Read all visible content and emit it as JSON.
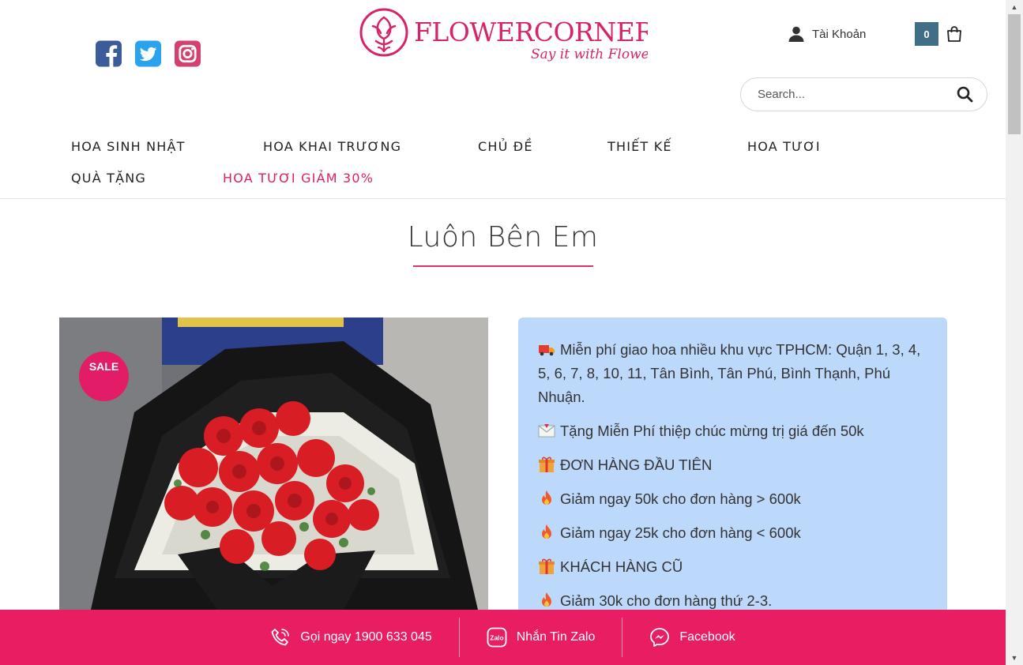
{
  "header": {
    "logo": {
      "brand": "FLOWERCORNER",
      "tagline": "Say it with Flowers"
    },
    "social": [
      "facebook",
      "twitter",
      "instagram"
    ],
    "account_label": "Tài Khoản",
    "cart_count": "0",
    "search_placeholder": "Search..."
  },
  "nav": {
    "items": [
      {
        "label": "HOA SINH NHẬT"
      },
      {
        "label": "HOA KHAI TRƯƠNG"
      },
      {
        "label": "CHỦ ĐỀ"
      },
      {
        "label": "THIẾT KẾ"
      },
      {
        "label": "HOA TƯƠI"
      },
      {
        "label": "QUÀ TẶNG"
      },
      {
        "label": "HOA TƯƠI GIẢM 30%"
      }
    ]
  },
  "product": {
    "title": "Luôn Bên Em",
    "badge": "SALE"
  },
  "promo": {
    "lines": [
      {
        "icon": "truck-emoji",
        "text": "Miễn phí giao hoa nhiều khu vực TPHCM: Quận 1, 3, 4, 5, 6, 7, 8, 10, 11, Tân Bình, Tân Phú, Bình Thạnh, Phú Nhuận."
      },
      {
        "icon": "envelope-emoji",
        "text": "Tặng Miễn Phí thiệp chúc mừng trị giá đến 50k"
      },
      {
        "icon": "gift-emoji",
        "text": "ĐƠN HÀNG ĐẦU TIÊN"
      },
      {
        "icon": "fire-emoji",
        "text": "Giảm ngay 50k cho đơn hàng > 600k"
      },
      {
        "icon": "fire-emoji",
        "text": "Giảm ngay 25k cho đơn hàng < 600k"
      },
      {
        "icon": "gift-emoji",
        "text": "KHÁCH HÀNG CŨ"
      },
      {
        "icon": "fire-emoji",
        "text": "Giảm 30k cho đơn hàng thứ 2-3."
      }
    ]
  },
  "bottom_bar": {
    "call_label": "Gọi ngay 1900 633 045",
    "zalo_label": "Nhắn Tin Zalo",
    "facebook_label": "Facebook"
  },
  "colors": {
    "brand_pink": "#e21c67",
    "cart_badge": "#3f6e86",
    "promo_bg": "#bcd9fc",
    "bottom_bar": "#e91d62"
  }
}
